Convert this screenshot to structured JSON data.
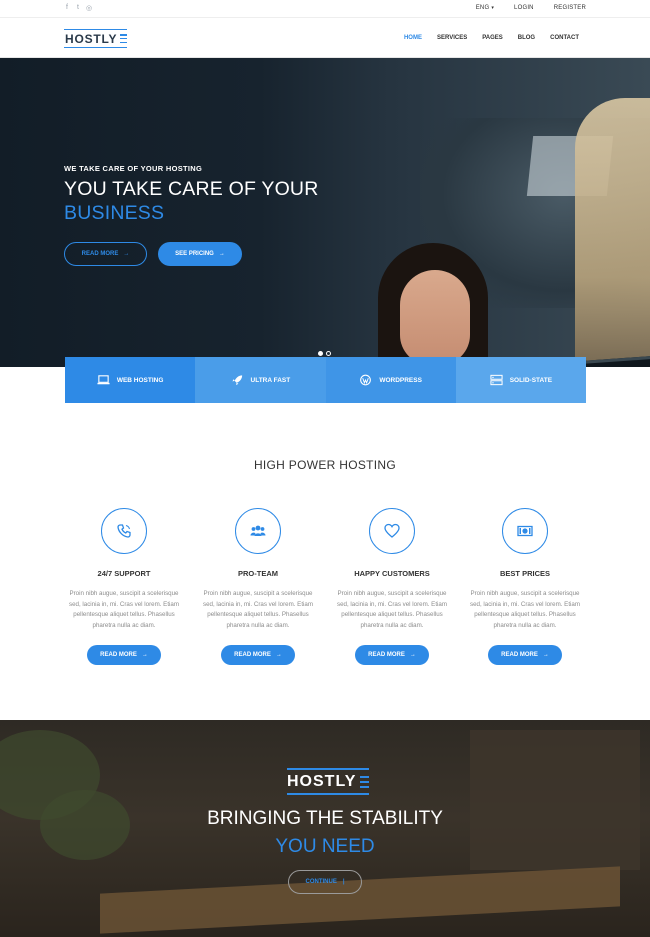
{
  "topbar": {
    "social": [
      {
        "icon": "facebook-icon",
        "glyph": "f"
      },
      {
        "icon": "twitter-icon",
        "glyph": "t"
      },
      {
        "icon": "instagram-icon",
        "glyph": "◎"
      }
    ],
    "language": "ENG",
    "login": "LOGIN",
    "register": "REGISTER"
  },
  "nav": {
    "logo": "HOSTLY",
    "items": [
      "HOME",
      "SERVICES",
      "PAGES",
      "BLOG",
      "CONTACT"
    ],
    "active": "HOME"
  },
  "hero": {
    "subtitle": "WE TAKE CARE OF YOUR HOSTING",
    "title_line1": "YOU TAKE CARE OF YOUR",
    "title_line2": "BUSINESS",
    "btn_read_more": "READ MORE",
    "btn_see_pricing": "SEE PRICING",
    "arrow": "→"
  },
  "features": [
    {
      "label": "WEB HOSTING",
      "icon": "laptop-icon"
    },
    {
      "label": "ULTRA FAST",
      "icon": "rocket-icon"
    },
    {
      "label": "WORDPRESS",
      "icon": "wordpress-icon"
    },
    {
      "label": "SOLID-STATE",
      "icon": "server-icon"
    }
  ],
  "services": {
    "title": "HIGH POWER HOSTING",
    "items": [
      {
        "name": "24/7 SUPPORT",
        "icon": "phone-icon",
        "desc": "Proin nibh augue, suscipit a scelerisque sed, lacinia in, mi. Cras vel lorem. Etiam pellentesque aliquet tellus. Phasellus pharetra nulla ac diam.",
        "button": "READ MORE"
      },
      {
        "name": "PRO-TEAM",
        "icon": "team-icon",
        "desc": "Proin nibh augue, suscipit a scelerisque sed, lacinia in, mi. Cras vel lorem. Etiam pellentesque aliquet tellus. Phasellus pharetra nulla ac diam.",
        "button": "READ MORE"
      },
      {
        "name": "HAPPY CUSTOMERS",
        "icon": "heart-icon",
        "desc": "Proin nibh augue, suscipit a scelerisque sed, lacinia in, mi. Cras vel lorem. Etiam pellentesque aliquet tellus. Phasellus pharetra nulla ac diam.",
        "button": "READ MORE"
      },
      {
        "name": "BEST PRICES",
        "icon": "money-icon",
        "desc": "Proin nibh augue, suscipit a scelerisque sed, lacinia in, mi. Cras vel lorem. Etiam pellentesque aliquet tellus. Phasellus pharetra nulla ac diam.",
        "button": "READ MORE"
      }
    ]
  },
  "band": {
    "logo": "HOSTLY",
    "title_line1": "BRINGING THE STABILITY",
    "title_line2": "YOU NEED",
    "button": "CONTINUE",
    "button_glyph": "|"
  },
  "colors": {
    "accent": "#2e8ae6",
    "dark": "#17232e"
  }
}
